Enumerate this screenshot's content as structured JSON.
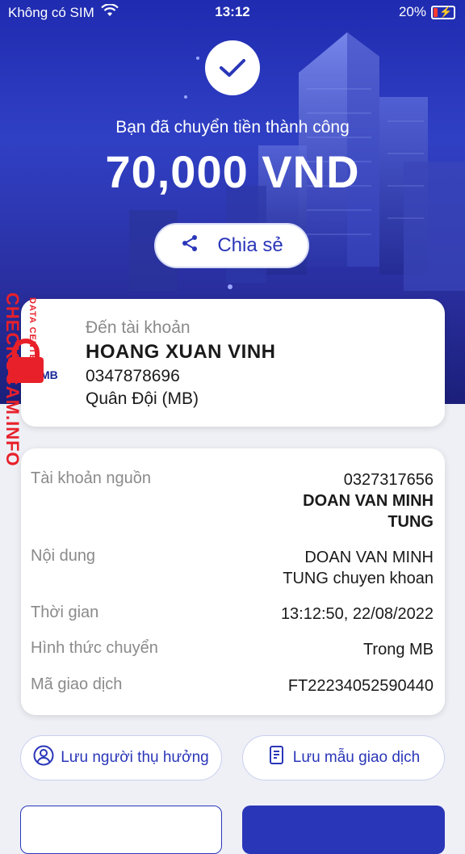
{
  "status_bar": {
    "carrier": "Không có SIM",
    "time": "13:12",
    "battery": "20%"
  },
  "hero": {
    "message": "Bạn đã chuyển tiền thành công",
    "amount": "70,000 VND",
    "share_label": "Chia sẻ"
  },
  "recipient": {
    "label": "Đến tài khoản",
    "name": "HOANG XUAN VINH",
    "account": "0347878696",
    "bank": "Quân Đội (MB)",
    "bank_logo": "MB"
  },
  "details": {
    "source_label": "Tài khoản nguồn",
    "source_account": "0327317656",
    "source_name_line1": "DOAN VAN MINH",
    "source_name_line2": "TUNG",
    "content_label": "Nội dung",
    "content_line1": "DOAN VAN MINH",
    "content_line2": "TUNG chuyen khoan",
    "time_label": "Thời gian",
    "time_value": "13:12:50, 22/08/2022",
    "method_label": "Hình thức chuyển",
    "method_value": "Trong MB",
    "txn_label": "Mã giao dịch",
    "txn_value": "FT22234052590440"
  },
  "actions": {
    "save_beneficiary": "Lưu người thụ hưởng",
    "save_template": "Lưu mẫu giao dịch"
  },
  "watermark": {
    "main": "CHECKSCAM.INFO",
    "sub": "DATA CENTER"
  },
  "colors": {
    "primary": "#2a36b8",
    "hero_bg": "#2a34b4",
    "watermark": "#e8202a"
  }
}
